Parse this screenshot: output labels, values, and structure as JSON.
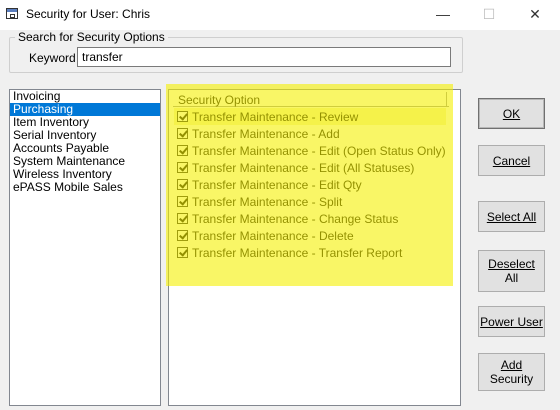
{
  "window": {
    "title": "Security for User: Chris",
    "min_glyph": "—",
    "max_glyph": "☐",
    "close_glyph": "✕"
  },
  "search": {
    "group_label": "Search for Security Options",
    "keyword_label": "Keyword",
    "keyword_value": "transfer"
  },
  "modules": {
    "items": [
      {
        "label": "Invoicing",
        "selected": false
      },
      {
        "label": "Purchasing",
        "selected": true
      },
      {
        "label": "Item Inventory",
        "selected": false
      },
      {
        "label": "Serial Inventory",
        "selected": false
      },
      {
        "label": "Accounts Payable",
        "selected": false
      },
      {
        "label": "System Maintenance",
        "selected": false
      },
      {
        "label": "Wireless Inventory",
        "selected": false
      },
      {
        "label": "ePASS Mobile Sales",
        "selected": false
      }
    ]
  },
  "options": {
    "column_header": "Security Option",
    "rows": [
      {
        "label": "Transfer Maintenance - Review",
        "checked": true
      },
      {
        "label": "Transfer Maintenance - Add",
        "checked": true
      },
      {
        "label": "Transfer Maintenance - Edit (Open Status Only)",
        "checked": true
      },
      {
        "label": "Transfer Maintenance - Edit (All Statuses)",
        "checked": true
      },
      {
        "label": "Transfer Maintenance - Edit Qty",
        "checked": true
      },
      {
        "label": "Transfer Maintenance - Split",
        "checked": true
      },
      {
        "label": "Transfer Maintenance - Change Status",
        "checked": true
      },
      {
        "label": "Transfer Maintenance - Delete",
        "checked": true
      },
      {
        "label": "Transfer Maintenance - Transfer Report",
        "checked": true
      }
    ]
  },
  "buttons": {
    "ok": "OK",
    "cancel": "Cancel",
    "select_all": "Select All",
    "deselect_line1": "Deselect",
    "deselect_line2": "All",
    "power_user": "Power User",
    "add_line1": "Add",
    "add_line2": "Security"
  },
  "highlight_color": "#f5f000"
}
